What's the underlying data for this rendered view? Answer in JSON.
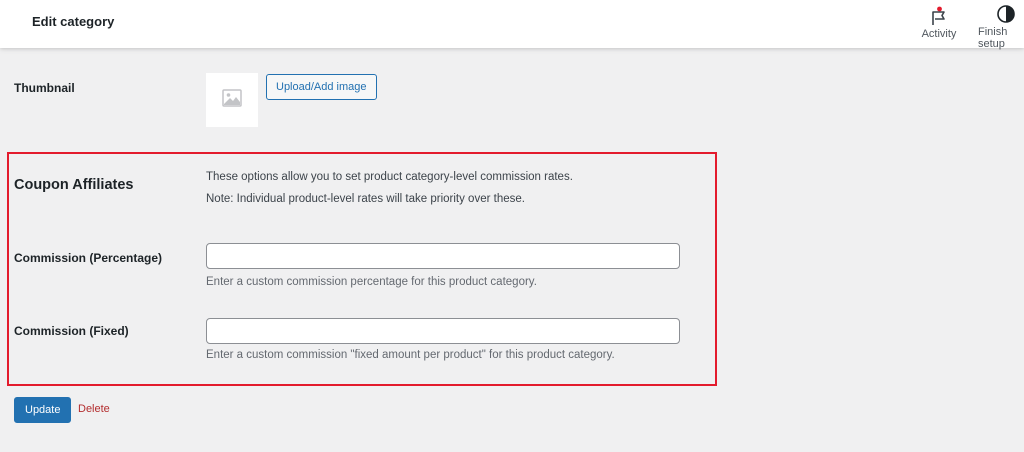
{
  "header": {
    "title": "Edit category",
    "actions": [
      {
        "label": "Activity",
        "icon": "flag-icon"
      },
      {
        "label": "Finish setup",
        "icon": "half-circle-icon"
      }
    ]
  },
  "thumbnail": {
    "label": "Thumbnail",
    "placeholder_icon": "image-placeholder-icon",
    "upload_button": "Upload/Add image"
  },
  "coupon_affiliates": {
    "title": "Coupon Affiliates",
    "description_line1": "These options allow you to set product category-level commission rates.",
    "description_line2": "Note: Individual product-level rates will take priority over these.",
    "percentage": {
      "label": "Commission (Percentage)",
      "value": "",
      "help": "Enter a custom commission percentage for this product category."
    },
    "fixed": {
      "label": "Commission (Fixed)",
      "value": "",
      "help": "Enter a custom commission \"fixed amount per product\" for this product category."
    },
    "highlight_color": "#e31b2d"
  },
  "actions": {
    "update": "Update",
    "delete": "Delete"
  },
  "colors": {
    "primary": "#2271b1",
    "danger": "#b32d2e",
    "background": "#f0f0f1"
  }
}
